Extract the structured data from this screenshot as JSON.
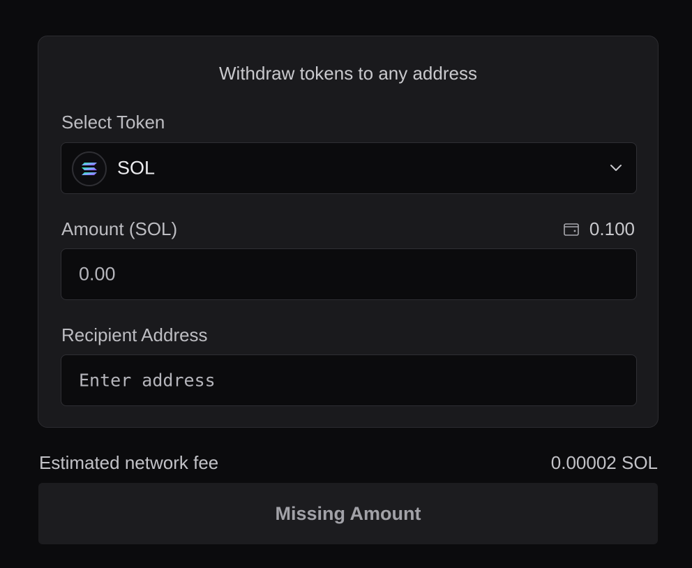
{
  "card": {
    "title": "Withdraw tokens to any address"
  },
  "token_select": {
    "label": "Select Token",
    "selected": "SOL",
    "icon": "solana-logo-icon"
  },
  "amount": {
    "label": "Amount (SOL)",
    "value": "0.00",
    "balance_icon": "wallet-icon",
    "balance": "0.100"
  },
  "recipient": {
    "label": "Recipient Address",
    "placeholder": "Enter address"
  },
  "fee": {
    "label": "Estimated network fee",
    "value": "0.00002 SOL"
  },
  "action": {
    "label": "Missing Amount"
  },
  "colors": {
    "background": "#0b0b0d",
    "card": "#1a1a1d",
    "input": "#0b0b0d",
    "border": "#2f2f34",
    "solana_green": "#19fb9b",
    "solana_purple": "#9945ff"
  }
}
